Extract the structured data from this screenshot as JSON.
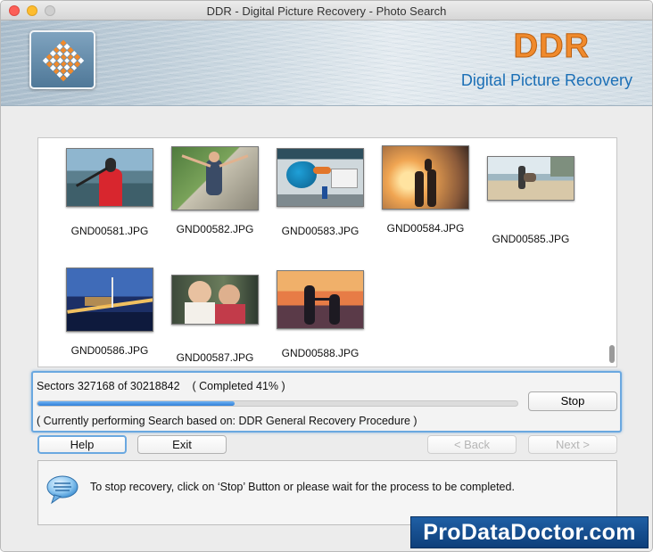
{
  "window": {
    "title": "DDR - Digital Picture Recovery - Photo Search"
  },
  "banner": {
    "brand": "DDR",
    "product": "Digital Picture Recovery",
    "logo_icon": "checkered-diamond-logo-icon",
    "brand_color": "#f08a2c",
    "product_color": "#1b6fb6"
  },
  "thumbnails": [
    {
      "filename": "GND00581.JPG",
      "scene": "red kayak on river"
    },
    {
      "filename": "GND00582.JPG",
      "scene": "hiker with arms raised"
    },
    {
      "filename": "GND00583.JPG",
      "scene": "kingfisher mural wall"
    },
    {
      "filename": "GND00584.JPG",
      "scene": "family at sunset"
    },
    {
      "filename": "GND00585.JPG",
      "scene": "person on beach"
    },
    {
      "filename": "GND00586.JPG",
      "scene": "city bridge at night"
    },
    {
      "filename": "GND00587.JPG",
      "scene": "two women smiling"
    },
    {
      "filename": "GND00588.JPG",
      "scene": "silhouettes at dusk"
    }
  ],
  "progress": {
    "sectors_text": "Sectors 327168 of 30218842",
    "completed_text": "( Completed 41% )",
    "percent": 41,
    "status_text": "( Currently performing Search based on: DDR General Recovery Procedure )",
    "stop_label": "Stop",
    "accent": "#6aa8e0"
  },
  "buttons": {
    "help": "Help",
    "exit": "Exit",
    "back": "< Back",
    "next": "Next >"
  },
  "info": {
    "icon": "speech-bubble-icon",
    "text": "To stop recovery, click on ‘Stop’ Button or please wait for the process to be completed."
  },
  "watermark": {
    "text": "ProDataDoctor.com"
  }
}
